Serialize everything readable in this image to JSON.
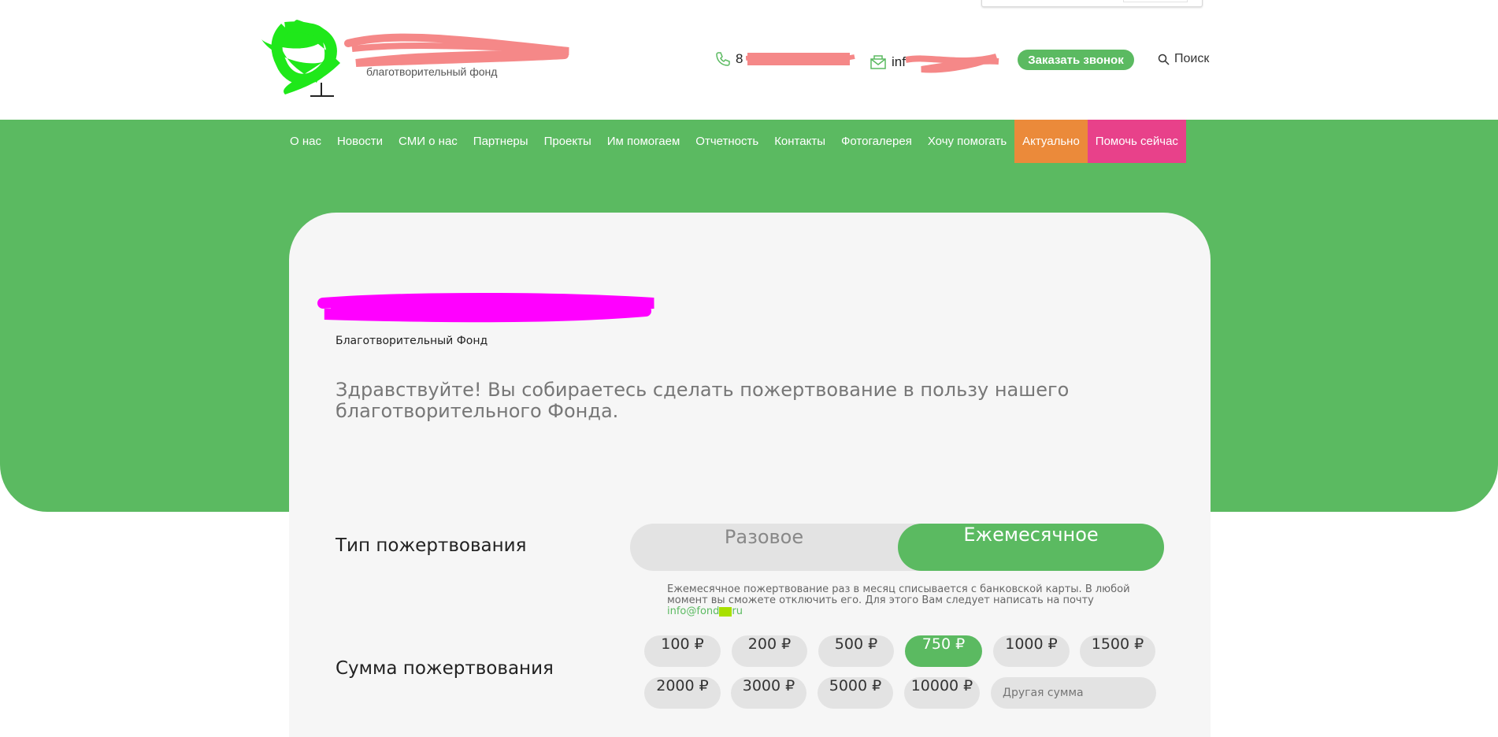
{
  "header": {
    "logo_subtitle": "благотворительный фонд",
    "phone_prefix": "8",
    "email_prefix": "inf",
    "callback_label": "Заказать звонок",
    "search_label": "Поиск"
  },
  "nav": {
    "items": [
      {
        "label": "О нас"
      },
      {
        "label": "Новости"
      },
      {
        "label": "СМИ о нас"
      },
      {
        "label": "Партнеры"
      },
      {
        "label": "Проекты"
      },
      {
        "label": "Им помогаем"
      },
      {
        "label": "Отчетность"
      },
      {
        "label": "Контакты"
      },
      {
        "label": "Фотогалерея"
      },
      {
        "label": "Хочу помогать"
      },
      {
        "label": "Актуально"
      },
      {
        "label": "Помочь сейчас"
      }
    ]
  },
  "card": {
    "subtitle": "Благотворительный Фонд",
    "greeting": "Здравствуйте! Вы собираетесь сделать пожертвование в пользу нашего благотворительного Фонда.",
    "donation_type_label": "Тип пожертвования",
    "type_once": "Разовое",
    "type_monthly": "Ежемесячное",
    "note": "Ежемесячное пожертвование раз в месяц списывается с банковской карты. В любой момент вы сможете отключить его. Для этого Вам следует написать на почту",
    "note_email_start": "info@fond",
    "note_email_end": "ru",
    "amount_label": "Сумма пожертвования",
    "amounts": [
      "100 ₽",
      "200 ₽",
      "500 ₽",
      "750 ₽",
      "1000 ₽",
      "1500 ₽",
      "2000 ₽",
      "3000 ₽",
      "5000 ₽",
      "10000 ₽"
    ],
    "selected_amount": "750 ₽",
    "other_placeholder": "Другая сумма"
  },
  "colors": {
    "brand_green": "#5bba61",
    "actual_orange": "#eb8a3a",
    "help_pink": "#e8418a"
  }
}
